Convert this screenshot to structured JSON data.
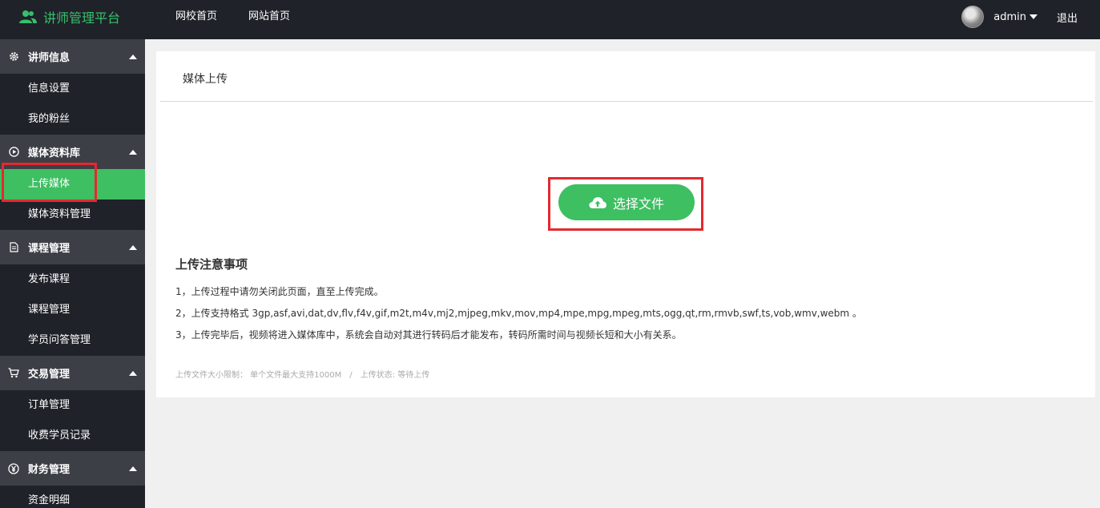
{
  "header": {
    "brand_label": "讲师管理平台",
    "nav": [
      "网校首页",
      "网站首页"
    ],
    "user_name": "admin",
    "logout_label": "退出"
  },
  "sidebar": {
    "sections": [
      {
        "label": "讲师信息",
        "icon": "gear-icon",
        "items": [
          "信息设置",
          "我的粉丝"
        ]
      },
      {
        "label": "媒体资料库",
        "icon": "play-circle-icon",
        "items": [
          "上传媒体",
          "媒体资料管理"
        ]
      },
      {
        "label": "课程管理",
        "icon": "document-icon",
        "items": [
          "发布课程",
          "课程管理",
          "学员问答管理"
        ]
      },
      {
        "label": "交易管理",
        "icon": "cart-icon",
        "items": [
          "订单管理",
          "收费学员记录"
        ]
      },
      {
        "label": "财务管理",
        "icon": "yen-circle-icon",
        "items": [
          "资金明细"
        ]
      }
    ],
    "active_item": "上传媒体"
  },
  "main": {
    "title": "媒体上传",
    "upload_button_label": "选择文件",
    "notes_title": "上传注意事项",
    "notes": [
      "1，上传过程中请勿关闭此页面，直至上传完成。",
      "2，上传支持格式 3gp,asf,avi,dat,dv,flv,f4v,gif,m2t,m4v,mj2,mjpeg,mkv,mov,mp4,mpe,mpg,mpeg,mts,ogg,qt,rm,rmvb,swf,ts,vob,wmv,webm 。",
      "3，上传完毕后，视频将进入媒体库中，系统会自动对其进行转码后才能发布，转码所需时间与视频长短和大小有关系。"
    ],
    "size_limit_text": "上传文件大小限制： 单个文件最大支持1000M",
    "separator": "/",
    "status_text": "上传状态: 等待上传"
  },
  "colors": {
    "accent_green": "#3dbf62",
    "highlight_red": "#e5292f",
    "sidebar_bg": "#1f2229",
    "section_bg": "#3c3f46"
  }
}
